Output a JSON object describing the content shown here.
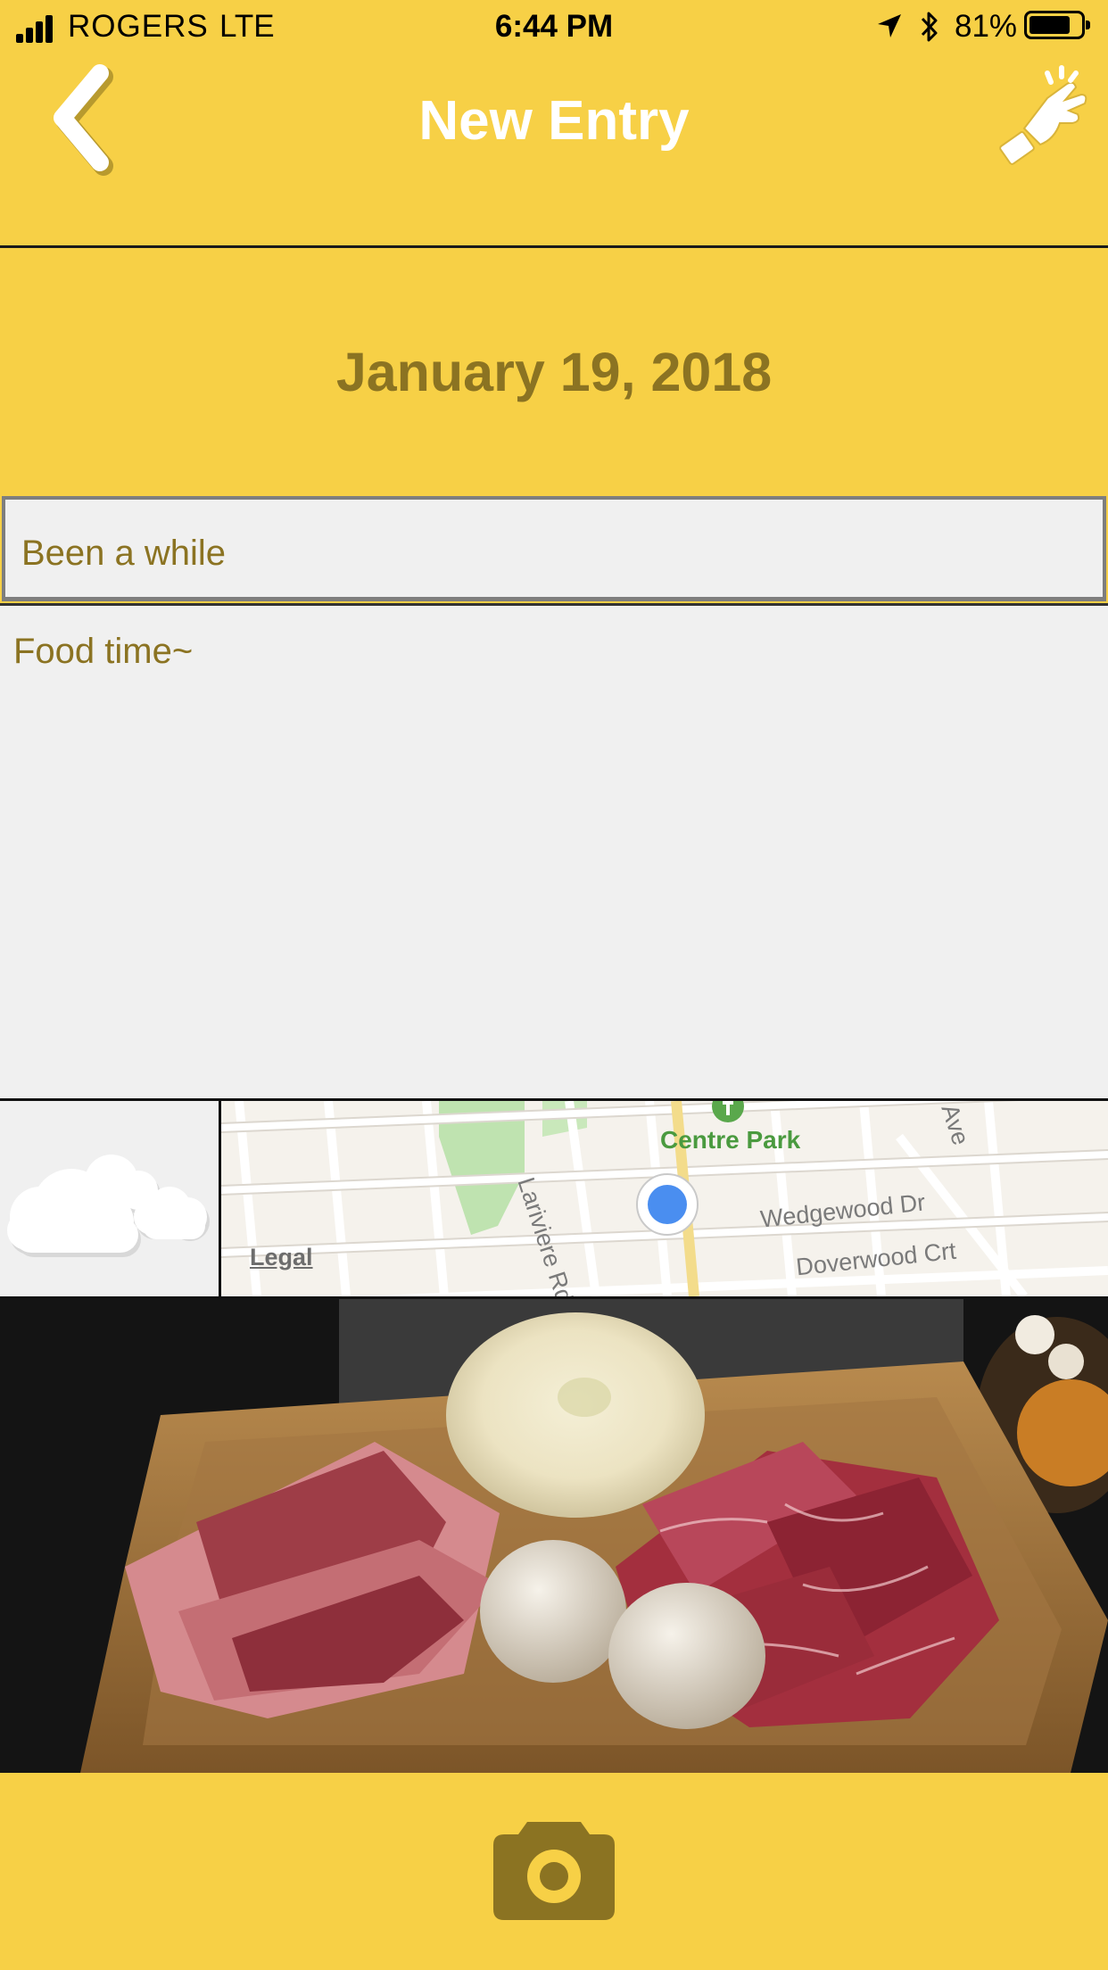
{
  "status_bar": {
    "carrier": "ROGERS",
    "network": "LTE",
    "time": "6:44 PM",
    "battery": "81%",
    "battery_level": 0.81,
    "icons": [
      "signal-icon",
      "location-arrow-icon",
      "bluetooth-icon",
      "battery-icon"
    ]
  },
  "nav": {
    "title": "New Entry",
    "back_icon": "chevron-left-icon",
    "action_icon": "snap-hand-icon"
  },
  "entry": {
    "date": "January 19, 2018",
    "title_value": "Been a while",
    "body_value": "Food time~"
  },
  "weather": {
    "icon": "cloud-icon"
  },
  "map": {
    "labels": {
      "park": "Centre Park",
      "road1": "Lariviere Rd",
      "road2": "Wedgewood Dr",
      "road3": "Doverwood Crt",
      "road4": "Ave",
      "legal": "Legal"
    },
    "pin_icon": "location-pin-icon"
  },
  "photo": {
    "description_icon": "food-photo"
  },
  "toolbar": {
    "camera_icon": "camera-icon"
  },
  "colors": {
    "background": "#f7d046",
    "accent_text": "#8b7322",
    "field_background": "#f0f0f0",
    "map_pin": "#4a8ef0"
  }
}
